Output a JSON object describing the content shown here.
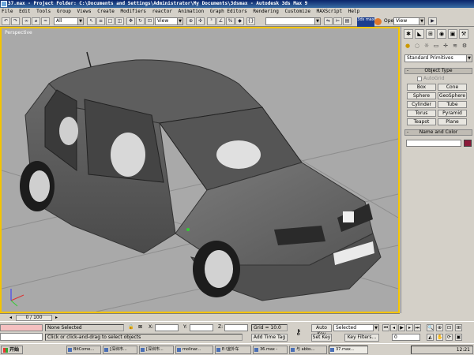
{
  "window": {
    "title": "37.max - Project Folder: C:\\Documents and Settings\\Administrator\\My Documents\\3dsmax - Autodesk 3ds Max 9"
  },
  "menu": [
    "File",
    "Edit",
    "Tools",
    "Group",
    "Views",
    "Create",
    "Modifiers",
    "reactor",
    "Animation",
    "Graph Editors",
    "Rendering",
    "Customize",
    "MAXScript",
    "Help"
  ],
  "toolbar": {
    "selection_filter": "All",
    "ref_coord": "View",
    "named_selection": "",
    "renderer_label": "OpenGL",
    "right_combo": "View",
    "logo_text": "3ds max"
  },
  "viewport": {
    "label": "Perspective"
  },
  "command_panel": {
    "category": "Standard Primitives",
    "object_type_title": "Object Type",
    "autogrid_label": "AutoGrid",
    "buttons": [
      "Box",
      "Cone",
      "Sphere",
      "GeoSphere",
      "Cylinder",
      "Tube",
      "Torus",
      "Pyramid",
      "Teapot",
      "Plane"
    ],
    "name_color_title": "Name and Color",
    "object_name": "",
    "object_color": "#8b1a3a"
  },
  "time_slider": {
    "position": "0 / 100"
  },
  "status": {
    "selection": "None Selected",
    "prompt": "Click or click-and-drag to select objects",
    "x_label": "X:",
    "y_label": "Y:",
    "z_label": "Z:",
    "x_value": "",
    "y_value": "",
    "z_value": "",
    "grid": "Grid = 10.0",
    "add_time_tag": "Add Time Tag",
    "auto_key": "Auto Key",
    "set_key": "Set Key",
    "selected_combo": "Selected",
    "key_filters": "Key Filters...",
    "frame": "0"
  },
  "taskbar": {
    "start_label": "开始",
    "tasks": [
      "BitCome...",
      "[深圳市...",
      "[深圳市...",
      "molinar...",
      "E:\\室外车",
      "36.max -",
      "与 abbs...",
      "37.max..."
    ],
    "clock": "12:21"
  }
}
